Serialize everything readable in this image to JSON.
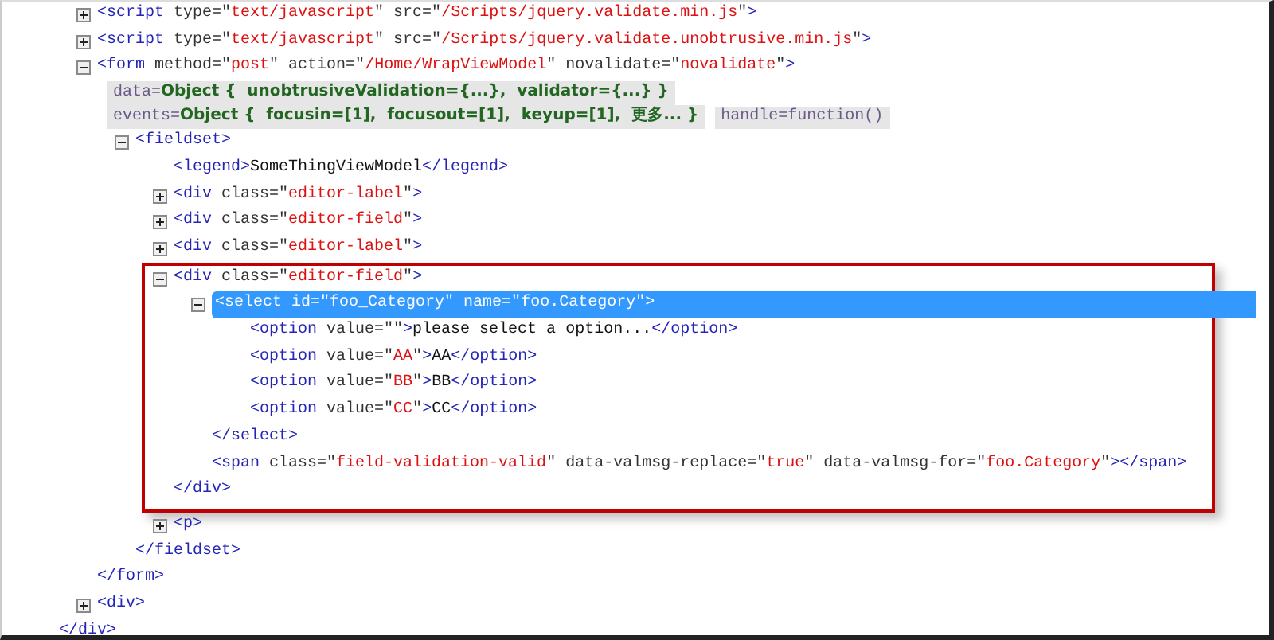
{
  "tree": {
    "close": "</div>",
    "children": [
      {
        "expanded": false,
        "parts": [
          {
            "kind": "tag",
            "text": "<script"
          },
          {
            "kind": "attr",
            "text": " type=\""
          },
          {
            "kind": "value",
            "text": "text/javascript"
          },
          {
            "kind": "attr",
            "text": "\" src=\""
          },
          {
            "kind": "value",
            "text": "/Scripts/jquery.validate.min.js"
          },
          {
            "kind": "attr",
            "text": "\""
          },
          {
            "kind": "tag",
            "text": ">"
          }
        ]
      },
      {
        "expanded": false,
        "parts": [
          {
            "kind": "tag",
            "text": "<script"
          },
          {
            "kind": "attr",
            "text": " type=\""
          },
          {
            "kind": "value",
            "text": "text/javascript"
          },
          {
            "kind": "attr",
            "text": "\" src=\""
          },
          {
            "kind": "value",
            "text": "/Scripts/jquery.validate.unobtrusive.min.js"
          },
          {
            "kind": "attr",
            "text": "\""
          },
          {
            "kind": "tag",
            "text": ">"
          }
        ]
      },
      {
        "expanded": true,
        "parts": [
          {
            "kind": "tag",
            "text": "<form"
          },
          {
            "kind": "attr",
            "text": " method=\""
          },
          {
            "kind": "value",
            "text": "post"
          },
          {
            "kind": "attr",
            "text": "\" action=\""
          },
          {
            "kind": "value",
            "text": "/Home/WrapViewModel"
          },
          {
            "kind": "attr",
            "text": "\" novalidate=\""
          },
          {
            "kind": "value",
            "text": "novalidate"
          },
          {
            "kind": "attr",
            "text": "\""
          },
          {
            "kind": "tag",
            "text": ">"
          }
        ],
        "badges": [
          {
            "label": "data=",
            "value": "Object {  unobtrusiveValidation={...},  validator={...} }"
          },
          {
            "label": "events=",
            "value": "Object {  focusin=[1],  focusout=[1],  keyup=[1],  更多... }"
          },
          {
            "label": "handle=function()"
          }
        ],
        "close": "</form>",
        "children": [
          {
            "expanded": true,
            "parts": [
              {
                "kind": "tag",
                "text": "<fieldset>"
              }
            ],
            "close": "</fieldset>",
            "children": [
              {
                "parts": [
                  {
                    "kind": "tag",
                    "text": "<legend>"
                  },
                  {
                    "kind": "text",
                    "text": "SomeThingViewModel"
                  },
                  {
                    "kind": "tag",
                    "text": "</legend>"
                  }
                ]
              },
              {
                "expanded": false,
                "parts": [
                  {
                    "kind": "tag",
                    "text": "<div"
                  },
                  {
                    "kind": "attr",
                    "text": " class=\""
                  },
                  {
                    "kind": "value",
                    "text": "editor-label"
                  },
                  {
                    "kind": "attr",
                    "text": "\""
                  },
                  {
                    "kind": "tag",
                    "text": ">"
                  }
                ]
              },
              {
                "expanded": false,
                "parts": [
                  {
                    "kind": "tag",
                    "text": "<div"
                  },
                  {
                    "kind": "attr",
                    "text": " class=\""
                  },
                  {
                    "kind": "value",
                    "text": "editor-field"
                  },
                  {
                    "kind": "attr",
                    "text": "\""
                  },
                  {
                    "kind": "tag",
                    "text": ">"
                  }
                ]
              },
              {
                "expanded": false,
                "parts": [
                  {
                    "kind": "tag",
                    "text": "<div"
                  },
                  {
                    "kind": "attr",
                    "text": " class=\""
                  },
                  {
                    "kind": "value",
                    "text": "editor-label"
                  },
                  {
                    "kind": "attr",
                    "text": "\""
                  },
                  {
                    "kind": "tag",
                    "text": ">"
                  }
                ]
              },
              {
                "expanded": true,
                "highlighted": true,
                "parts": [
                  {
                    "kind": "tag",
                    "text": "<div"
                  },
                  {
                    "kind": "attr",
                    "text": " class=\""
                  },
                  {
                    "kind": "value",
                    "text": "editor-field"
                  },
                  {
                    "kind": "attr",
                    "text": "\""
                  },
                  {
                    "kind": "tag",
                    "text": ">"
                  }
                ],
                "close": "</div>",
                "children": [
                  {
                    "expanded": true,
                    "selected": true,
                    "parts": [
                      {
                        "kind": "tag",
                        "text": "<select"
                      },
                      {
                        "kind": "attr",
                        "text": " id=\""
                      },
                      {
                        "kind": "value",
                        "text": "foo_Category"
                      },
                      {
                        "kind": "attr",
                        "text": "\" name=\""
                      },
                      {
                        "kind": "value",
                        "text": "foo.Category"
                      },
                      {
                        "kind": "attr",
                        "text": "\""
                      },
                      {
                        "kind": "tag",
                        "text": ">"
                      }
                    ],
                    "close": "</select>",
                    "children": [
                      {
                        "parts": [
                          {
                            "kind": "tag",
                            "text": "<option"
                          },
                          {
                            "kind": "attr",
                            "text": " value=\"\""
                          },
                          {
                            "kind": "tag",
                            "text": ">"
                          },
                          {
                            "kind": "text",
                            "text": "please select a option..."
                          },
                          {
                            "kind": "tag",
                            "text": "</option>"
                          }
                        ]
                      },
                      {
                        "parts": [
                          {
                            "kind": "tag",
                            "text": "<option"
                          },
                          {
                            "kind": "attr",
                            "text": " value=\""
                          },
                          {
                            "kind": "value",
                            "text": "AA"
                          },
                          {
                            "kind": "attr",
                            "text": "\""
                          },
                          {
                            "kind": "tag",
                            "text": ">"
                          },
                          {
                            "kind": "text",
                            "text": "AA"
                          },
                          {
                            "kind": "tag",
                            "text": "</option>"
                          }
                        ]
                      },
                      {
                        "parts": [
                          {
                            "kind": "tag",
                            "text": "<option"
                          },
                          {
                            "kind": "attr",
                            "text": " value=\""
                          },
                          {
                            "kind": "value",
                            "text": "BB"
                          },
                          {
                            "kind": "attr",
                            "text": "\""
                          },
                          {
                            "kind": "tag",
                            "text": ">"
                          },
                          {
                            "kind": "text",
                            "text": "BB"
                          },
                          {
                            "kind": "tag",
                            "text": "</option>"
                          }
                        ]
                      },
                      {
                        "parts": [
                          {
                            "kind": "tag",
                            "text": "<option"
                          },
                          {
                            "kind": "attr",
                            "text": " value=\""
                          },
                          {
                            "kind": "value",
                            "text": "CC"
                          },
                          {
                            "kind": "attr",
                            "text": "\""
                          },
                          {
                            "kind": "tag",
                            "text": ">"
                          },
                          {
                            "kind": "text",
                            "text": "CC"
                          },
                          {
                            "kind": "tag",
                            "text": "</option>"
                          }
                        ]
                      }
                    ]
                  },
                  {
                    "parts": [
                      {
                        "kind": "tag",
                        "text": "<span"
                      },
                      {
                        "kind": "attr",
                        "text": " class=\""
                      },
                      {
                        "kind": "value",
                        "text": "field-validation-valid"
                      },
                      {
                        "kind": "attr",
                        "text": "\" data-valmsg-replace=\""
                      },
                      {
                        "kind": "value",
                        "text": "true"
                      },
                      {
                        "kind": "attr",
                        "text": "\" data-valmsg-for=\""
                      },
                      {
                        "kind": "value",
                        "text": "foo.Category"
                      },
                      {
                        "kind": "attr",
                        "text": "\""
                      },
                      {
                        "kind": "tag",
                        "text": "></span>"
                      }
                    ]
                  }
                ]
              },
              {
                "expanded": false,
                "parts": [
                  {
                    "kind": "tag",
                    "text": "<p>"
                  }
                ]
              }
            ]
          }
        ]
      },
      {
        "expanded": false,
        "parts": [
          {
            "kind": "tag",
            "text": "<div>"
          }
        ]
      }
    ]
  }
}
